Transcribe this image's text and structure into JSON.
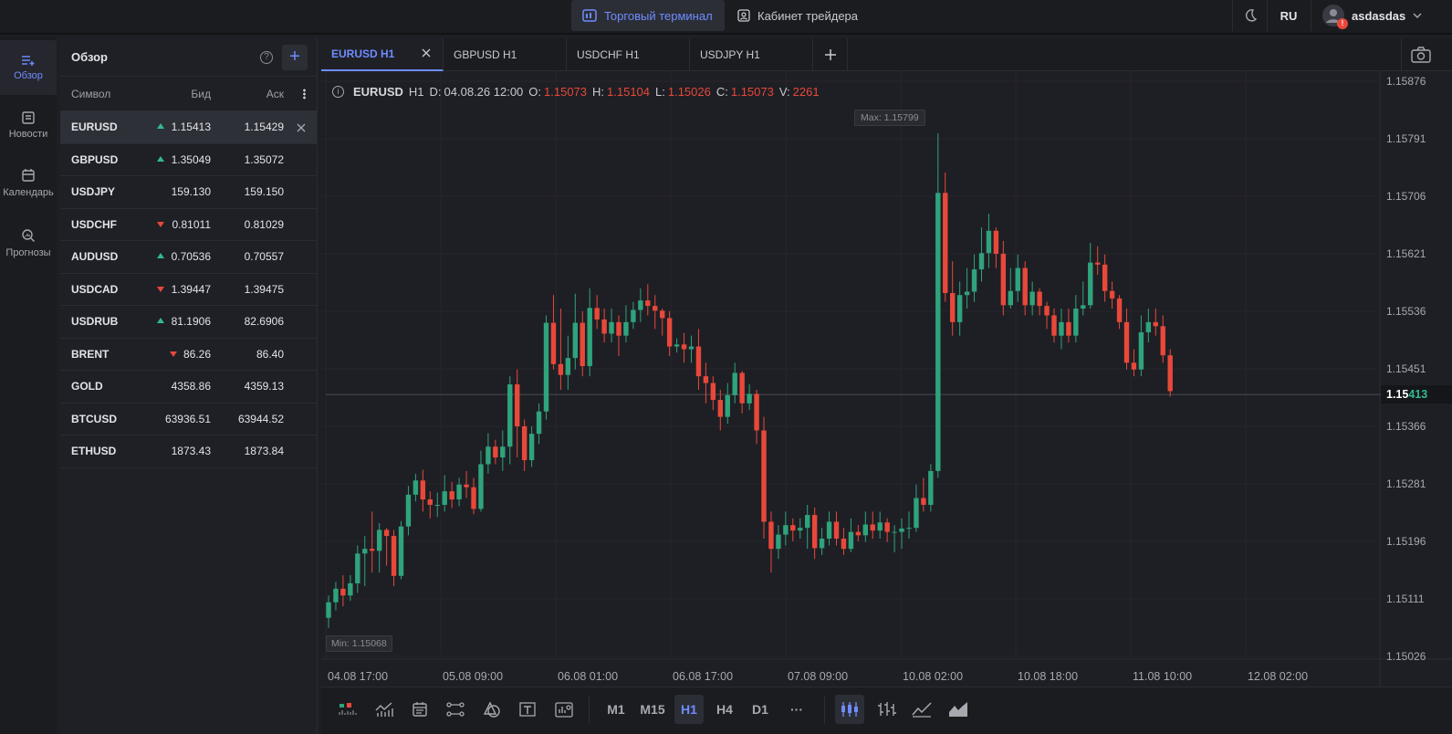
{
  "topbar": {
    "terminal_label": "Торговый терминал",
    "cabinet_label": "Кабинет трейдера",
    "lang": "RU",
    "username": "asdasdas",
    "notification_badge": "!"
  },
  "sidebar": {
    "items": [
      {
        "label": "Обзор",
        "icon": "list-add-icon"
      },
      {
        "label": "Новости",
        "icon": "news-icon"
      },
      {
        "label": "Календарь",
        "icon": "calendar-icon"
      },
      {
        "label": "Прогнозы",
        "icon": "search-chart-icon"
      }
    ]
  },
  "watchlist": {
    "title": "Обзор",
    "col_symbol": "Символ",
    "col_bid": "Бид",
    "col_ask": "Аск",
    "rows": [
      {
        "symbol": "EURUSD",
        "bid": "1.15413",
        "ask": "1.15429",
        "dir": "up"
      },
      {
        "symbol": "GBPUSD",
        "bid": "1.35049",
        "ask": "1.35072",
        "dir": "up"
      },
      {
        "symbol": "USDJPY",
        "bid": "159.130",
        "ask": "159.150",
        "dir": "none"
      },
      {
        "symbol": "USDCHF",
        "bid": "0.81011",
        "ask": "0.81029",
        "dir": "down"
      },
      {
        "symbol": "AUDUSD",
        "bid": "0.70536",
        "ask": "0.70557",
        "dir": "up"
      },
      {
        "symbol": "USDCAD",
        "bid": "1.39447",
        "ask": "1.39475",
        "dir": "down"
      },
      {
        "symbol": "USDRUB",
        "bid": "81.1906",
        "ask": "82.6906",
        "dir": "up"
      },
      {
        "symbol": "BRENT",
        "bid": "86.26",
        "ask": "86.40",
        "dir": "down"
      },
      {
        "symbol": "GOLD",
        "bid": "4358.86",
        "ask": "4359.13",
        "dir": "none"
      },
      {
        "symbol": "BTCUSD",
        "bid": "63936.51",
        "ask": "63944.52",
        "dir": "none"
      },
      {
        "symbol": "ETHUSD",
        "bid": "1873.43",
        "ask": "1873.84",
        "dir": "none"
      }
    ]
  },
  "tabs": [
    {
      "label": "EURUSD H1",
      "active": true
    },
    {
      "label": "GBPUSD H1",
      "active": false
    },
    {
      "label": "USDCHF H1",
      "active": false
    },
    {
      "label": "USDJPY H1",
      "active": false
    }
  ],
  "ohlc": {
    "symbol": "EURUSD",
    "tf": "H1",
    "d_label": "D:",
    "date": "04.08.26 12:00",
    "o_label": "O:",
    "o": "1.15073",
    "h_label": "H:",
    "h": "1.15104",
    "l_label": "L:",
    "l": "1.15026",
    "c_label": "C:",
    "c": "1.15073",
    "v_label": "V:",
    "v": "2261"
  },
  "chart": {
    "max_label": "Max: 1.15799",
    "min_label": "Min: 1.15068",
    "price_main": "1.15",
    "price_highlight": "413",
    "up_color": "#2fa37c",
    "down_color": "#e8483a"
  },
  "chart_data": {
    "type": "candlestick",
    "ylim": [
      1.15026,
      1.15876
    ],
    "yticks": [
      "1.15876",
      "1.15791",
      "1.15706",
      "1.15621",
      "1.15536",
      "1.15451",
      "1.15366",
      "1.15281",
      "1.15196",
      "1.15111",
      "1.15026"
    ],
    "xticks": [
      "04.08 17:00",
      "05.08 09:00",
      "06.08 01:00",
      "06.08 17:00",
      "07.08 09:00",
      "10.08 02:00",
      "10.08 18:00",
      "11.08 10:00",
      "12.08 02:00"
    ],
    "current_price": 1.15413,
    "candles": [
      [
        1.15083,
        1.15106,
        1.15068,
        1.15116
      ],
      [
        1.15106,
        1.15126,
        1.15094,
        1.15136
      ],
      [
        1.15126,
        1.15116,
        1.151,
        1.15146
      ],
      [
        1.15116,
        1.15134,
        1.15108,
        1.15146
      ],
      [
        1.15134,
        1.15178,
        1.1512,
        1.1519
      ],
      [
        1.15178,
        1.15185,
        1.1513,
        1.15204
      ],
      [
        1.15185,
        1.15182,
        1.1515,
        1.1524
      ],
      [
        1.15182,
        1.15213,
        1.1515,
        1.15223
      ],
      [
        1.15213,
        1.15204,
        1.1516,
        1.15216
      ],
      [
        1.15204,
        1.15145,
        1.1513,
        1.15213
      ],
      [
        1.15145,
        1.15218,
        1.1514,
        1.15226
      ],
      [
        1.15218,
        1.15265,
        1.15205,
        1.15278
      ],
      [
        1.15265,
        1.15286,
        1.15255,
        1.15296
      ],
      [
        1.15286,
        1.15258,
        1.1524,
        1.15302
      ],
      [
        1.15258,
        1.1525,
        1.1523,
        1.1527
      ],
      [
        1.1525,
        1.1525,
        1.15232,
        1.15268
      ],
      [
        1.1525,
        1.1527,
        1.1524,
        1.15294
      ],
      [
        1.1527,
        1.15258,
        1.15245,
        1.15284
      ],
      [
        1.15258,
        1.1528,
        1.15248,
        1.1529
      ],
      [
        1.1528,
        1.15276,
        1.1526,
        1.153
      ],
      [
        1.15276,
        1.15244,
        1.15236,
        1.1529
      ],
      [
        1.15244,
        1.1531,
        1.1524,
        1.1533
      ],
      [
        1.1531,
        1.15336,
        1.15296,
        1.15356
      ],
      [
        1.15336,
        1.1532,
        1.1531,
        1.15346
      ],
      [
        1.1532,
        1.15336,
        1.153,
        1.1536
      ],
      [
        1.15336,
        1.15428,
        1.1531,
        1.1544
      ],
      [
        1.15428,
        1.15366,
        1.1532,
        1.1545
      ],
      [
        1.15366,
        1.15316,
        1.153,
        1.15376
      ],
      [
        1.15316,
        1.15355,
        1.15306,
        1.15366
      ],
      [
        1.15355,
        1.15388,
        1.1534,
        1.154
      ],
      [
        1.15388,
        1.15519,
        1.15376,
        1.1553
      ],
      [
        1.15519,
        1.15458,
        1.1545,
        1.1556
      ],
      [
        1.15458,
        1.15442,
        1.1542,
        1.1554
      ],
      [
        1.15442,
        1.15467,
        1.1542,
        1.155
      ],
      [
        1.15467,
        1.15519,
        1.1545,
        1.15562
      ],
      [
        1.15519,
        1.15455,
        1.1544,
        1.15536
      ],
      [
        1.15455,
        1.15541,
        1.1544,
        1.1557
      ],
      [
        1.15541,
        1.15524,
        1.1551,
        1.1556
      ],
      [
        1.15524,
        1.15503,
        1.1549,
        1.1554
      ],
      [
        1.15503,
        1.1552,
        1.1549,
        1.1554
      ],
      [
        1.1552,
        1.155,
        1.1547,
        1.1553
      ],
      [
        1.155,
        1.1552,
        1.1549,
        1.15545
      ],
      [
        1.1552,
        1.15538,
        1.1551,
        1.1555
      ],
      [
        1.15538,
        1.15552,
        1.1552,
        1.1557
      ],
      [
        1.15552,
        1.15544,
        1.1553,
        1.15576
      ],
      [
        1.15544,
        1.15537,
        1.1551,
        1.1556
      ],
      [
        1.15537,
        1.15526,
        1.155,
        1.1554
      ],
      [
        1.15526,
        1.15484,
        1.1547,
        1.15536
      ],
      [
        1.15484,
        1.15487,
        1.15475,
        1.15496
      ],
      [
        1.15487,
        1.1548,
        1.1546,
        1.15504
      ],
      [
        1.1548,
        1.15484,
        1.1546,
        1.155
      ],
      [
        1.15484,
        1.1544,
        1.1542,
        1.1551
      ],
      [
        1.1544,
        1.1543,
        1.154,
        1.1546
      ],
      [
        1.1543,
        1.15405,
        1.1539,
        1.1544
      ],
      [
        1.15405,
        1.1538,
        1.1536,
        1.1542
      ],
      [
        1.1538,
        1.15412,
        1.1537,
        1.1543
      ],
      [
        1.15412,
        1.15445,
        1.154,
        1.1546
      ],
      [
        1.15445,
        1.154,
        1.15385,
        1.15448
      ],
      [
        1.154,
        1.15414,
        1.1539,
        1.15428
      ],
      [
        1.15414,
        1.1536,
        1.1534,
        1.1542
      ],
      [
        1.1536,
        1.15225,
        1.152,
        1.1538
      ],
      [
        1.15225,
        1.15185,
        1.1515,
        1.1524
      ],
      [
        1.15185,
        1.15206,
        1.1517,
        1.1522
      ],
      [
        1.15206,
        1.1522,
        1.1519,
        1.1524
      ],
      [
        1.1522,
        1.15212,
        1.15196,
        1.1523
      ],
      [
        1.15212,
        1.15216,
        1.152,
        1.1523
      ],
      [
        1.15216,
        1.15235,
        1.15185,
        1.1525
      ],
      [
        1.15235,
        1.15186,
        1.1517,
        1.15246
      ],
      [
        1.15186,
        1.152,
        1.15176,
        1.15216
      ],
      [
        1.152,
        1.15225,
        1.1519,
        1.1524
      ],
      [
        1.15225,
        1.152,
        1.1519,
        1.1524
      ],
      [
        1.152,
        1.15185,
        1.15176,
        1.15216
      ],
      [
        1.15185,
        1.1521,
        1.1518,
        1.1523
      ],
      [
        1.1521,
        1.15205,
        1.15196,
        1.1522
      ],
      [
        1.15205,
        1.15221,
        1.15195,
        1.1524
      ],
      [
        1.15221,
        1.15212,
        1.152,
        1.1524
      ],
      [
        1.15212,
        1.15224,
        1.152,
        1.1524
      ],
      [
        1.15224,
        1.1521,
        1.15195,
        1.1523
      ],
      [
        1.1521,
        1.1521,
        1.1518,
        1.1522
      ],
      [
        1.1521,
        1.15215,
        1.15185,
        1.1523
      ],
      [
        1.15215,
        1.15216,
        1.152,
        1.1524
      ],
      [
        1.15216,
        1.1526,
        1.1521,
        1.1528
      ],
      [
        1.1526,
        1.1525,
        1.1524,
        1.1529
      ],
      [
        1.1525,
        1.153,
        1.1524,
        1.1531
      ],
      [
        1.153,
        1.15711,
        1.1529,
        1.15799
      ],
      [
        1.15711,
        1.15563,
        1.1555,
        1.15741
      ],
      [
        1.15563,
        1.1552,
        1.155,
        1.1561
      ],
      [
        1.1552,
        1.1556,
        1.155,
        1.1558
      ],
      [
        1.1556,
        1.15565,
        1.1554,
        1.156
      ],
      [
        1.15565,
        1.15598,
        1.1555,
        1.1562
      ],
      [
        1.15598,
        1.15622,
        1.1558,
        1.1566
      ],
      [
        1.15622,
        1.15655,
        1.156,
        1.1568
      ],
      [
        1.15655,
        1.15621,
        1.156,
        1.1566
      ],
      [
        1.15621,
        1.15545,
        1.1553,
        1.1564
      ],
      [
        1.15545,
        1.15566,
        1.1554,
        1.156
      ],
      [
        1.15566,
        1.156,
        1.1555,
        1.1562
      ],
      [
        1.156,
        1.15545,
        1.1553,
        1.1561
      ],
      [
        1.15545,
        1.15565,
        1.1553,
        1.1558
      ],
      [
        1.15565,
        1.15544,
        1.1553,
        1.1557
      ],
      [
        1.15544,
        1.1553,
        1.1551,
        1.1555
      ],
      [
        1.1553,
        1.155,
        1.1549,
        1.1554
      ],
      [
        1.155,
        1.1552,
        1.1548,
        1.1554
      ],
      [
        1.1552,
        1.155,
        1.1549,
        1.1554
      ],
      [
        1.155,
        1.1554,
        1.1549,
        1.1556
      ],
      [
        1.1554,
        1.15545,
        1.1553,
        1.1558
      ],
      [
        1.15545,
        1.15608,
        1.1554,
        1.15637
      ],
      [
        1.15608,
        1.15605,
        1.1559,
        1.15632
      ],
      [
        1.15605,
        1.15566,
        1.1555,
        1.1562
      ],
      [
        1.15566,
        1.15555,
        1.1554,
        1.1558
      ],
      [
        1.15555,
        1.1552,
        1.1551,
        1.1556
      ],
      [
        1.1552,
        1.1546,
        1.1545,
        1.1554
      ],
      [
        1.1546,
        1.1545,
        1.1544,
        1.1548
      ],
      [
        1.1545,
        1.15505,
        1.1544,
        1.1553
      ],
      [
        1.15505,
        1.1552,
        1.1549,
        1.1554
      ],
      [
        1.1552,
        1.15514,
        1.155,
        1.1554
      ],
      [
        1.15514,
        1.15471,
        1.1546,
        1.1553
      ],
      [
        1.15471,
        1.15418,
        1.1541,
        1.1548
      ]
    ]
  },
  "toolbar": {
    "timeframes": [
      {
        "label": "M1",
        "active": false
      },
      {
        "label": "M15",
        "active": false
      },
      {
        "label": "H1",
        "active": true
      },
      {
        "label": "H4",
        "active": false
      },
      {
        "label": "D1",
        "active": false
      }
    ],
    "more_label": "···"
  }
}
